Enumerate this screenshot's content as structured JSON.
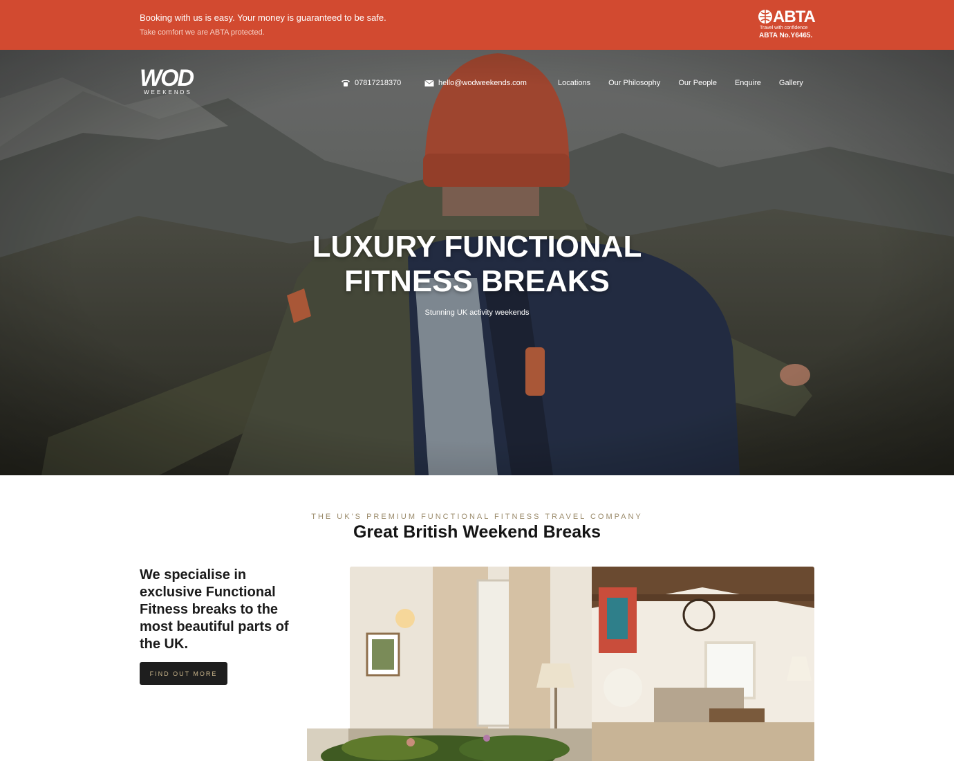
{
  "topbar": {
    "line1": "Booking with us is easy. Your money is guaranteed to be safe.",
    "line2": "Take comfort we are ABTA protected.",
    "abta_brand": "ABTA",
    "abta_tagline": "Travel with confidence",
    "abta_number": "ABTA No.Y6465."
  },
  "header": {
    "logo_main": "WOD",
    "logo_sub": "WEEKENDS",
    "phone": "07817218370",
    "email": "hello@wodweekends.com",
    "nav": [
      "Locations",
      "Our Philosophy",
      "Our People",
      "Enquire",
      "Gallery"
    ]
  },
  "hero": {
    "title_line1": "LUXURY FUNCTIONAL",
    "title_line2": "FITNESS BREAKS",
    "subtitle": "Stunning UK activity weekends"
  },
  "intro": {
    "eyebrow": "THE UK'S PREMIUM FUNCTIONAL FITNESS TRAVEL COMPANY",
    "heading": "Great British Weekend Breaks",
    "lead": "We specialise in exclusive Functional Fitness breaks to the most beautiful parts of the UK.",
    "cta": "FIND OUT MORE"
  },
  "colors": {
    "banner": "#d24a30",
    "accent_gold": "#9a8a6a",
    "button_bg": "#1e1e1e"
  },
  "icons": [
    "globe-icon",
    "phone-icon",
    "envelope-icon"
  ]
}
